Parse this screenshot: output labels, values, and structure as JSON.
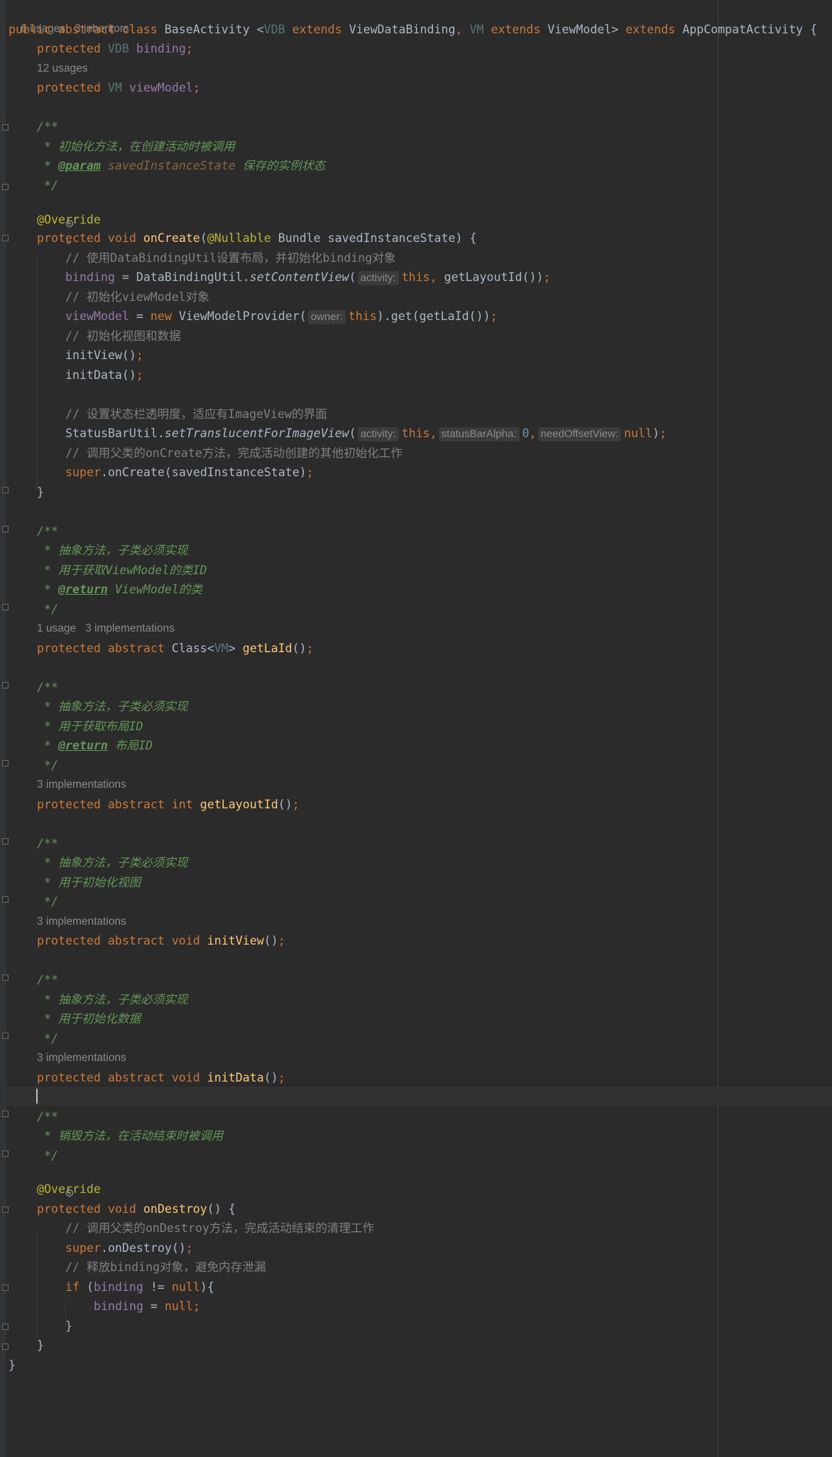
{
  "editor": {
    "class_hints": {
      "usages": "6 usages",
      "inheritors": "3 inheritors"
    },
    "class_decl": {
      "k1": "public abstract class",
      "name": "BaseActivity",
      "lt": " <",
      "g1": "VDB",
      "ext1": "extends",
      "b1": "ViewDataBinding",
      "comma": ",",
      "g2": "VM",
      "ext2": "extends",
      "b2": "ViewModel",
      "gt": ">",
      "ext3": "extends",
      "sup": "AppCompatActivity",
      "brace": "{"
    },
    "field_binding": {
      "mod": "protected",
      "type": "VDB",
      "name": "binding",
      "semi": ";"
    },
    "field_vm_hint": "12 usages",
    "field_vm": {
      "mod": "protected",
      "type": "VM",
      "name": "viewModel",
      "semi": ";"
    },
    "doc_oncreate": {
      "open": "/**",
      "l1": " * 初始化方法，在创建活动时被调用",
      "l2_star": " * ",
      "l2_tag": "@param",
      "l2_param": "savedInstanceState",
      "l2_text": " 保存的实例状态",
      "close": " */"
    },
    "annotation": "@Override",
    "oncreate_sig": {
      "mod": "protected void",
      "name": "onCreate",
      "p1": "(",
      "ann": "@Nullable",
      "rest": " Bundle savedInstanceState) {"
    },
    "oncreate_body": {
      "c1": "// 使用DataBindingUtil设置布局，并初始化binding对象",
      "s1_field": "binding",
      "s1_mid": " = DataBindingUtil.",
      "s1_method": "setContentView",
      "s1_paren": "(",
      "s1_hint": "activity:",
      "s1_this": "this,",
      "s1_rest": " getLayoutId())",
      "s1_semi": ";",
      "c2": "// 初始化viewModel对象",
      "s2_field": "viewModel",
      "s2_eq": " = ",
      "s2_new": "new",
      "s2_mid": " ViewModelProvider(",
      "s2_hint": "owner:",
      "s2_this": "this",
      "s2_rest": ").get(getLaId())",
      "s2_semi": ";",
      "c3": "// 初始化视图和数据",
      "s3": "initView()",
      "s3_semi": ";",
      "s4": "initData()",
      "s4_semi": ";",
      "c4": "// 设置状态栏透明度，适应有ImageView的界面",
      "s5_mid": "StatusBarUtil.",
      "s5_method": "setTranslucentForImageView",
      "s5_paren": "(",
      "s5_hint1": "activity:",
      "s5_this": "this,",
      "s5_hint2": "statusBarAlpha:",
      "s5_num": "0",
      "s5_comma": ",",
      "s5_hint3": "needOffsetView:",
      "s5_null": "null",
      "s5_end": ")",
      "s5_semi": ";",
      "c5": "// 调用父类的onCreate方法，完成活动创建的其他初始化工作",
      "s6_super": "super",
      "s6_rest": ".onCreate(savedInstanceState)",
      "s6_semi": ";",
      "close": "}"
    },
    "doc_getlaid": {
      "open": "/**",
      "l1": " * 抽象方法，子类必须实现",
      "l2": " * 用于获取ViewModel的类ID",
      "l3_star": " * ",
      "l3_tag": "@return",
      "l3_text": " ViewModel的类",
      "close": " */"
    },
    "getlaid_hints": {
      "usage": "1 usage",
      "impl": "3 implementations"
    },
    "getlaid_decl": {
      "mod": "protected abstract",
      "type": " Class<",
      "g": "VM",
      "gt": "> ",
      "name": "getLaId",
      "rest": "()",
      "semi": ";"
    },
    "doc_getlayout": {
      "open": "/**",
      "l1": " * 抽象方法，子类必须实现",
      "l2": " * 用于获取布局ID",
      "l3_star": " * ",
      "l3_tag": "@return",
      "l3_text": " 布局ID",
      "close": " */"
    },
    "getlayout_hint": "3 implementations",
    "getlayout_decl": {
      "mod": "protected abstract int",
      "name": "getLayoutId",
      "rest": "()",
      "semi": ";"
    },
    "doc_initview": {
      "open": "/**",
      "l1": " * 抽象方法，子类必须实现",
      "l2": " * 用于初始化视图",
      "close": " */"
    },
    "initview_hint": "3 implementations",
    "initview_decl": {
      "mod": "protected abstract void",
      "name": "initView",
      "rest": "()",
      "semi": ";"
    },
    "doc_initdata": {
      "open": "/**",
      "l1": " * 抽象方法，子类必须实现",
      "l2": " * 用于初始化数据",
      "close": " */"
    },
    "initdata_hint": "3 implementations",
    "initdata_decl": {
      "mod": "protected abstract void",
      "name": "initData",
      "rest": "()",
      "semi": ";"
    },
    "doc_ondestroy": {
      "open": "/**",
      "l1": " * 销毁方法，在活动结束时被调用",
      "close": " */"
    },
    "ondestroy_sig": {
      "mod": "protected void",
      "name": "onDestroy",
      "rest": "() {"
    },
    "ondestroy_body": {
      "c1": "// 调用父类的onDestroy方法，完成活动结束的清理工作",
      "s1_super": "super",
      "s1_rest": ".onDestroy()",
      "s1_semi": ";",
      "c2": "// 释放binding对象，避免内存泄漏",
      "if_kw": "if",
      "if_p": " (",
      "if_field": "binding",
      "if_op": " != ",
      "if_null": "null",
      "if_end": "){",
      "assign_field": "binding",
      "assign_eq": " = ",
      "assign_null": "null",
      "assign_semi": ";",
      "if_close": "}",
      "close": "}"
    },
    "class_close": "}"
  }
}
